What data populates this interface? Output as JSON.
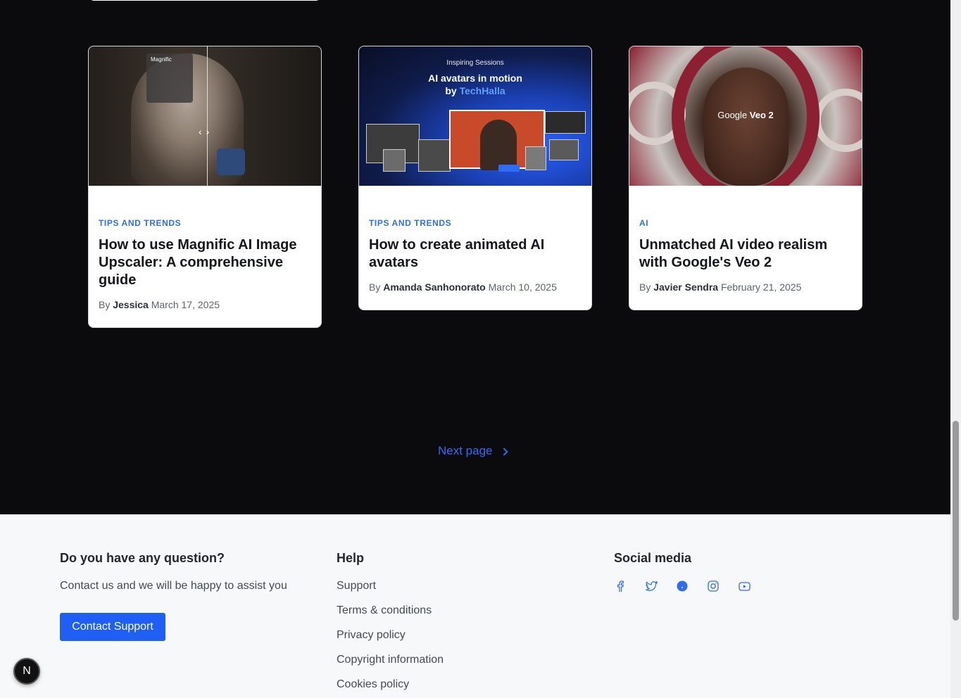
{
  "cards": [
    {
      "category": "TIPS AND TRENDS",
      "title": "How to use Magnific AI Image Upscaler: A comprehensive guide",
      "by": "By",
      "author": "Jessica",
      "date": "March 17, 2025",
      "thumb_text": "Magnific"
    },
    {
      "category": "TIPS AND TRENDS",
      "title": "How to create animated AI avatars",
      "by": "By",
      "author": "Amanda Sanhonorato",
      "date": "March 10, 2025",
      "thumb_line1": "Inspiring Sessions",
      "thumb_line2": "AI avatars in motion",
      "thumb_line3_prefix": "by",
      "thumb_line3_brand": "TechHalla"
    },
    {
      "category": "AI",
      "title": "Unmatched AI video realism with Google's Veo 2",
      "by": "By",
      "author": "Javier Sendra",
      "date": "February 21, 2025",
      "thumb_brand": "Google",
      "thumb_brand_bold": "Veo 2"
    }
  ],
  "pagination": {
    "next_label": "Next page"
  },
  "footer": {
    "question": {
      "heading": "Do you have any question?",
      "text": "Contact us and we will be happy to assist you",
      "button": "Contact Support"
    },
    "help": {
      "heading": "Help",
      "links": [
        "Support",
        "Terms & conditions",
        "Privacy policy",
        "Copyright information",
        "Cookies policy"
      ]
    },
    "social": {
      "heading": "Social media",
      "icons": [
        "facebook-icon",
        "twitter-icon",
        "pinterest-icon",
        "instagram-icon",
        "youtube-icon"
      ]
    }
  },
  "floating_badge": "N",
  "colors": {
    "accent": "#2f6cf5",
    "button": "#1f5ff5",
    "background": "#0b0b0e",
    "footer": "#f7f8fa"
  }
}
